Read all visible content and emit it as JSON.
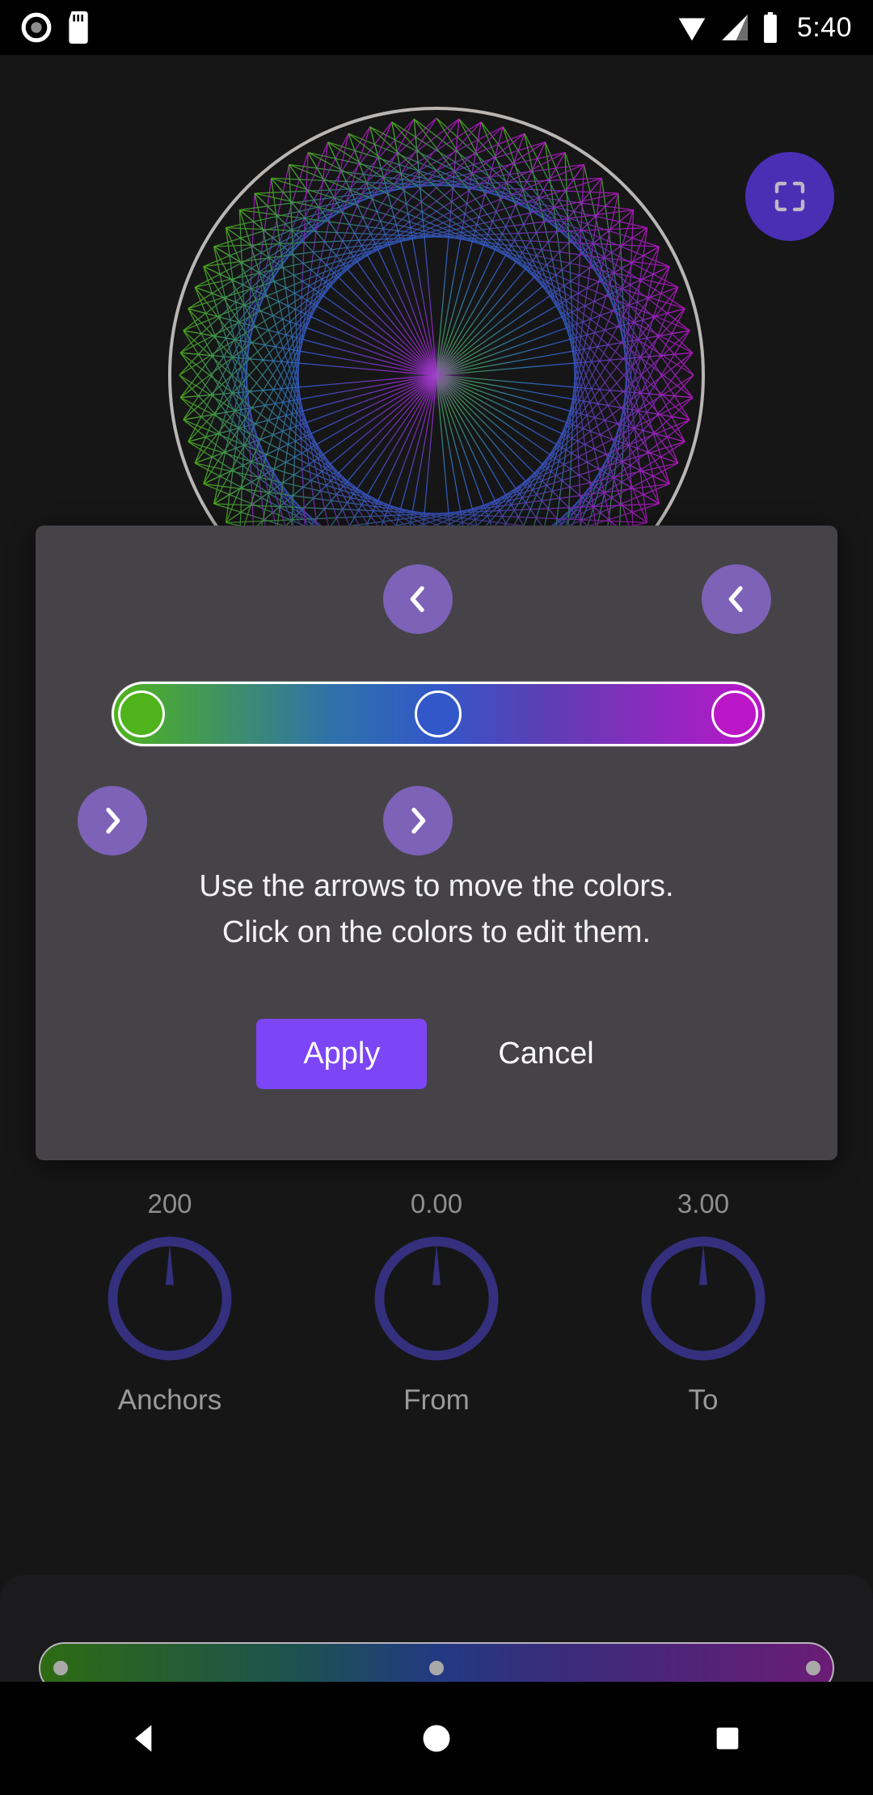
{
  "statusbar": {
    "time": "5:40",
    "icons": [
      "record-icon",
      "sd-card-icon",
      "wifi-icon",
      "signal-icon",
      "battery-icon"
    ]
  },
  "canvas": {
    "fullscreen_icon": "fullscreen-icon",
    "artwork": "spirograph-string-art"
  },
  "knobs": [
    {
      "label": "Anchors",
      "value": "200"
    },
    {
      "label": "From",
      "value": "0.00"
    },
    {
      "label": "To",
      "value": "3.00"
    }
  ],
  "gradient": {
    "stops": [
      {
        "name": "green-stop",
        "color": "#4fb31c",
        "position": 0
      },
      {
        "name": "blue-stop",
        "color": "#3257c8",
        "position": 50
      },
      {
        "name": "magenta-stop",
        "color": "#bb16c8",
        "position": 100
      }
    ],
    "bar_css": "linear-gradient(to right,#4fb31c 0%, #2f73a8 33%, #3257c8 50%, #5b3fb4 66%, #bb16c8 100%)",
    "preview_css": "linear-gradient(to right,#2e6b12 0%, #1d5151 33%, #223a82 50%, #3a2b7a 66%, #6b1c76 100%)"
  },
  "dialog": {
    "instruction_line1": "Use the arrows to move the colors.",
    "instruction_line2": "Click on the colors to edit them.",
    "apply_label": "Apply",
    "cancel_label": "Cancel",
    "arrows": {
      "left_top_mid": "chevron-left-icon",
      "left_top_right": "chevron-left-icon",
      "right_bottom_left": "chevron-right-icon",
      "right_bottom_mid": "chevron-right-icon"
    }
  },
  "navbar": {
    "back": "back-triangle-icon",
    "home": "home-circle-icon",
    "recents": "recents-square-icon"
  },
  "colors": {
    "accent_purple": "#7c45f5",
    "arrow_purple": "#7d62b8",
    "dialog_bg": "#454347",
    "knob_ring": "#34307e",
    "canvas_bg": "#161617"
  }
}
